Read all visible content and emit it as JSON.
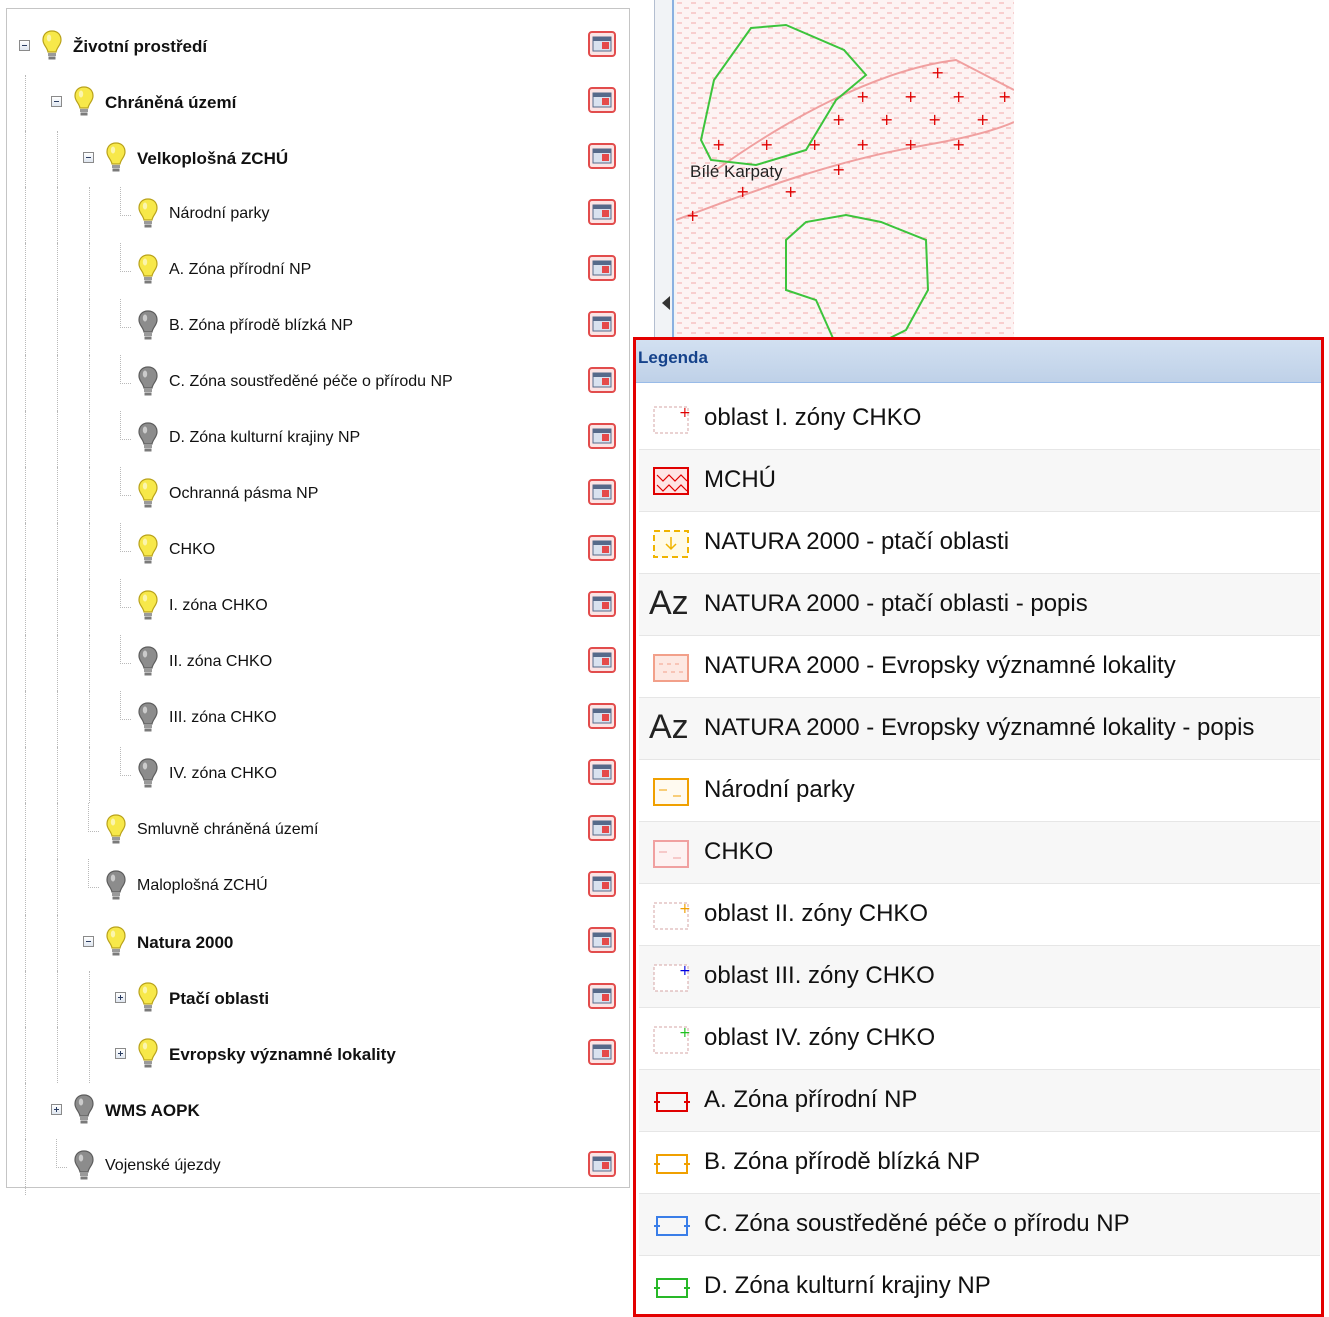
{
  "tree": {
    "items": [
      {
        "label": "Životní prostředí",
        "bold": true,
        "on": true,
        "toggle": "minus"
      },
      {
        "label": "Chráněná území",
        "bold": true,
        "on": true,
        "toggle": "minus"
      },
      {
        "label": "Velkoplošná ZCHÚ",
        "bold": true,
        "on": true,
        "toggle": "minus"
      },
      {
        "label": "Národní parky",
        "bold": false,
        "on": true
      },
      {
        "label": "A. Zóna přírodní NP",
        "bold": false,
        "on": true
      },
      {
        "label": "B. Zóna přírodě blízká NP",
        "bold": false,
        "on": false
      },
      {
        "label": "C. Zóna soustředěné péče o přírodu NP",
        "bold": false,
        "on": false
      },
      {
        "label": "D. Zóna kulturní krajiny NP",
        "bold": false,
        "on": false
      },
      {
        "label": "Ochranná pásma NP",
        "bold": false,
        "on": true
      },
      {
        "label": "CHKO",
        "bold": false,
        "on": true
      },
      {
        "label": "I. zóna CHKO",
        "bold": false,
        "on": true
      },
      {
        "label": "II. zóna CHKO",
        "bold": false,
        "on": false
      },
      {
        "label": "III. zóna CHKO",
        "bold": false,
        "on": false
      },
      {
        "label": "IV. zóna CHKO",
        "bold": false,
        "on": false
      },
      {
        "label": "Smluvně chráněná území",
        "bold": false,
        "on": true
      },
      {
        "label": "Maloplošná ZCHÚ",
        "bold": false,
        "on": false
      },
      {
        "label": "Natura 2000",
        "bold": true,
        "on": true,
        "toggle": "minus"
      },
      {
        "label": "Ptačí oblasti",
        "bold": true,
        "on": true,
        "toggle": "plus"
      },
      {
        "label": "Evropsky významné lokality",
        "bold": true,
        "on": true,
        "toggle": "plus"
      },
      {
        "label": "WMS AOPK",
        "bold": true,
        "on": false,
        "toggle": "plus",
        "no_legend": true
      },
      {
        "label": "Vojenské újezdy",
        "bold": false,
        "on": false
      }
    ]
  },
  "map": {
    "label": "Bílé Karpaty"
  },
  "legend": {
    "title": "Legenda",
    "items": [
      {
        "label": "oblast I. zóny CHKO",
        "symbol": "zone-red-icon"
      },
      {
        "label": "MCHÚ",
        "symbol": "mchu-hatch-icon"
      },
      {
        "label": "NATURA 2000 - ptačí oblasti",
        "symbol": "bird-area-icon"
      },
      {
        "label": "NATURA 2000 - ptačí oblasti - popis",
        "symbol": "Az"
      },
      {
        "label": "NATURA 2000 - Evropsky významné lokality",
        "symbol": "evl-icon"
      },
      {
        "label": "NATURA 2000 - Evropsky významné lokality - popis",
        "symbol": "Az"
      },
      {
        "label": "Národní parky",
        "symbol": "np-icon"
      },
      {
        "label": "CHKO",
        "symbol": "chko-icon"
      },
      {
        "label": "oblast II. zóny CHKO",
        "symbol": "zone-orange-icon"
      },
      {
        "label": "oblast III. zóny CHKO",
        "symbol": "zone-blue-icon"
      },
      {
        "label": "oblast IV. zóny CHKO",
        "symbol": "zone-green-icon"
      },
      {
        "label": "A. Zóna přírodní NP",
        "symbol": "np-zone-red-icon"
      },
      {
        "label": "B. Zóna přírodě blízká NP",
        "symbol": "np-zone-orange-icon"
      },
      {
        "label": "C. Zóna soustředěné péče o přírodu NP",
        "symbol": "np-zone-blue-icon"
      },
      {
        "label": "D. Zóna kulturní krajiny NP",
        "symbol": "np-zone-green-icon"
      }
    ]
  },
  "colors": {
    "legend_border": "#e30000",
    "bulb_on": "#f7e84a",
    "bulb_off": "#8c8c8c",
    "map_green": "#3cc43c",
    "map_pink": "#f4b8b8",
    "map_red": "#e00000"
  }
}
